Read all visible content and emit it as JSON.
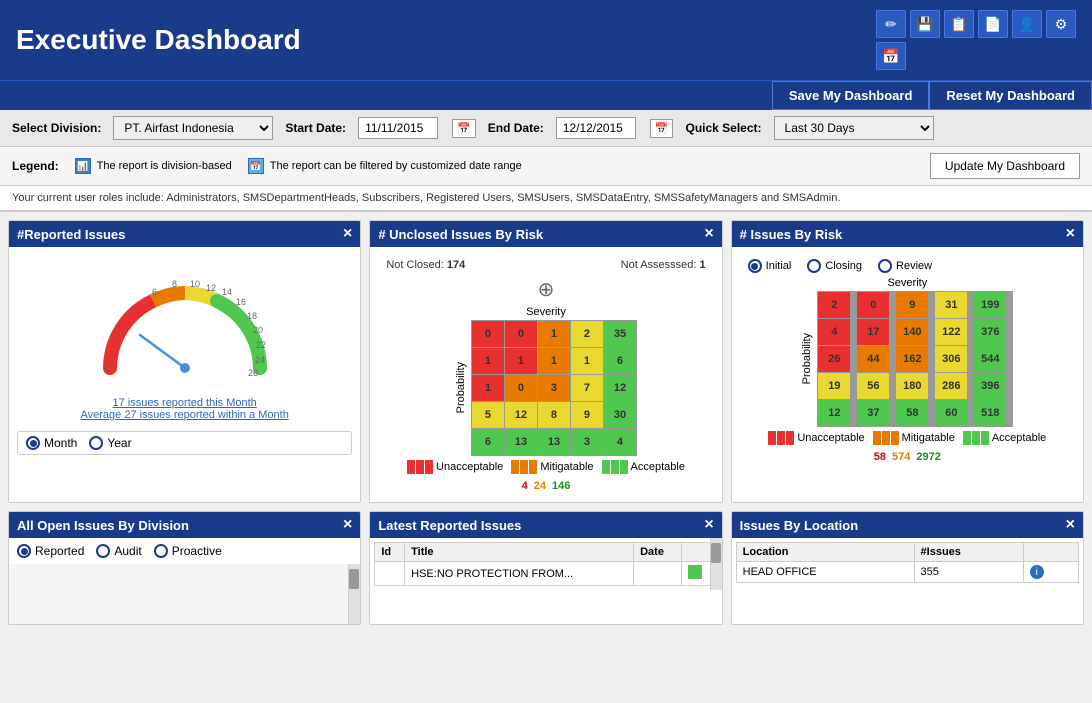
{
  "header": {
    "title": "Executive Dashboard",
    "icons": [
      "✏️",
      "💾",
      "📋",
      "📄",
      "👤",
      "⚙️",
      "📅"
    ]
  },
  "top_actions": {
    "save_label": "Save My Dashboard",
    "reset_label": "Reset My Dashboard"
  },
  "toolbar": {
    "division_label": "Select Division:",
    "division_value": "PT. Airfast Indonesia",
    "start_date_label": "Start Date:",
    "start_date_value": "11/11/2015",
    "end_date_label": "End Date:",
    "end_date_value": "12/12/2015",
    "quick_select_label": "Quick Select:",
    "quick_select_value": "Last 30 Days"
  },
  "legend": {
    "label": "Legend:",
    "item1": "The report is division-based",
    "item2": "The report can be filtered by customized date range",
    "update_btn": "Update My Dashboard"
  },
  "roles_notice": "Your current user roles include: Administrators, SMSDepartmentHeads, Subscribers, Registered Users, SMSUsers, SMSDataEntry, SMSSafetyManagers and SMSAdmin.",
  "widgets": {
    "reported_issues": {
      "title": "#Reported Issues",
      "gauge_value": 17,
      "gauge_max": 26,
      "stats_line1": "17 issues reported this Month",
      "stats_line2": "Average 27 issues reported within a Month",
      "radio_month": "Month",
      "radio_year": "Year"
    },
    "unclosed_issues": {
      "title": "# Unclosed Issues By Risk",
      "not_closed_label": "Not Closed:",
      "not_closed_value": "174",
      "not_assessed_label": "Not Assesssed:",
      "not_assessed_value": "1",
      "severity_label": "Severity",
      "probability_label": "Probability",
      "matrix": [
        [
          {
            "v": "0",
            "c": "red"
          },
          {
            "v": "0",
            "c": "red"
          },
          {
            "v": "1",
            "c": "orange"
          },
          {
            "v": "2",
            "c": "yellow"
          },
          {
            "v": "35",
            "c": "green"
          }
        ],
        [
          {
            "v": "1",
            "c": "red"
          },
          {
            "v": "1",
            "c": "red"
          },
          {
            "v": "1",
            "c": "orange"
          },
          {
            "v": "1",
            "c": "yellow"
          },
          {
            "v": "6",
            "c": "green"
          }
        ],
        [
          {
            "v": "1",
            "c": "red"
          },
          {
            "v": "0",
            "c": "orange"
          },
          {
            "v": "3",
            "c": "orange"
          },
          {
            "v": "7",
            "c": "yellow"
          },
          {
            "v": "12",
            "c": "green"
          }
        ],
        [
          {
            "v": "5",
            "c": "yellow"
          },
          {
            "v": "12",
            "c": "yellow"
          },
          {
            "v": "8",
            "c": "yellow"
          },
          {
            "v": "9",
            "c": "yellow"
          },
          {
            "v": "30",
            "c": "green"
          }
        ],
        [
          {
            "v": "6",
            "c": "green"
          },
          {
            "v": "13",
            "c": "green"
          },
          {
            "v": "13",
            "c": "green"
          },
          {
            "v": "3",
            "c": "green"
          },
          {
            "v": "4",
            "c": "green"
          }
        ]
      ],
      "legend": {
        "unacceptable_label": "Unacceptable",
        "unacceptable_val": "4",
        "mitigatable_label": "Mitigatable",
        "mitigatable_val": "24",
        "acceptable_label": "Acceptable",
        "acceptable_val": "146"
      }
    },
    "issues_by_risk": {
      "title": "# Issues By Risk",
      "radio_initial": "Initial",
      "radio_closing": "Closing",
      "radio_review": "Review",
      "severity_label": "Severity",
      "probability_label": "Probability",
      "matrix": [
        [
          {
            "v": "2",
            "c": "red"
          },
          {
            "v": "0",
            "c": "red"
          },
          {
            "v": "9",
            "c": "orange"
          },
          {
            "v": "31",
            "c": "yellow"
          },
          {
            "v": "199",
            "c": "green"
          }
        ],
        [
          {
            "v": "4",
            "c": "red"
          },
          {
            "v": "17",
            "c": "red"
          },
          {
            "v": "140",
            "c": "orange"
          },
          {
            "v": "122",
            "c": "yellow"
          },
          {
            "v": "376",
            "c": "green"
          }
        ],
        [
          {
            "v": "26",
            "c": "red"
          },
          {
            "v": "44",
            "c": "orange"
          },
          {
            "v": "162",
            "c": "orange"
          },
          {
            "v": "306",
            "c": "yellow"
          },
          {
            "v": "544",
            "c": "green"
          }
        ],
        [
          {
            "v": "19",
            "c": "yellow"
          },
          {
            "v": "56",
            "c": "yellow"
          },
          {
            "v": "180",
            "c": "yellow"
          },
          {
            "v": "286",
            "c": "yellow"
          },
          {
            "v": "396",
            "c": "green"
          }
        ],
        [
          {
            "v": "12",
            "c": "green"
          },
          {
            "v": "37",
            "c": "green"
          },
          {
            "v": "58",
            "c": "green"
          },
          {
            "v": "60",
            "c": "green"
          },
          {
            "v": "518",
            "c": "green"
          }
        ]
      ],
      "legend": {
        "unacceptable_label": "Unacceptable",
        "unacceptable_val": "58",
        "mitigatable_label": "Mitigatable",
        "mitigatable_val": "574",
        "acceptable_label": "Acceptable",
        "acceptable_val": "2972"
      }
    },
    "open_issues_division": {
      "title": "All Open Issues By Division",
      "radio_reported": "Reported",
      "radio_audit": "Audit",
      "radio_proactive": "Proactive"
    },
    "latest_reported": {
      "title": "Latest Reported Issues",
      "col_id": "Id",
      "col_title": "Title",
      "col_date": "Date",
      "row1_title": "HSE:NO PROTECTION FROM..."
    },
    "issues_by_location": {
      "title": "Issues By Location",
      "col_location": "Location",
      "col_issues": "#Issues",
      "row1_location": "HEAD OFFICE",
      "row1_issues": "355"
    }
  }
}
